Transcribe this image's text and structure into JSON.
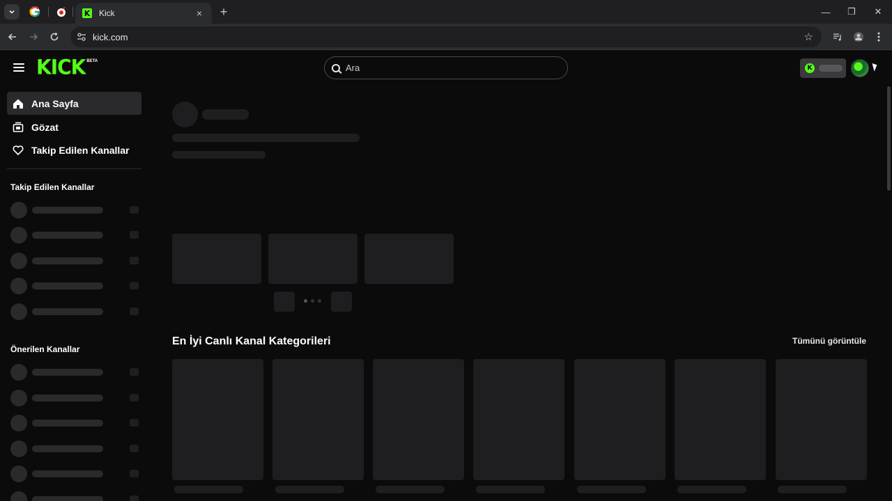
{
  "browser": {
    "tab_title": "Kick",
    "url": "kick.com",
    "new_tab": "+",
    "close_tab": "×",
    "minimize": "—",
    "restore": "❐",
    "close_window": "✕"
  },
  "header": {
    "logo_text": "KICK",
    "logo_badge": "BETA",
    "search_placeholder": "Ara"
  },
  "sidebar": {
    "nav": [
      {
        "label": "Ana Sayfa",
        "icon": "home-icon",
        "active": true
      },
      {
        "label": "Gözat",
        "icon": "browse-icon",
        "active": false
      },
      {
        "label": "Takip Edilen Kanallar",
        "icon": "heart-icon",
        "active": false
      }
    ],
    "following_heading": "Takip Edilen Kanallar",
    "recommended_heading": "Önerilen Kanallar"
  },
  "main": {
    "categories_title": "En İyi Canlı Kanal Kategorileri",
    "view_all": "Tümünü görüntüle"
  },
  "colors": {
    "brand": "#53fc18",
    "background": "#0b0b0c",
    "skeleton": "#222225"
  }
}
